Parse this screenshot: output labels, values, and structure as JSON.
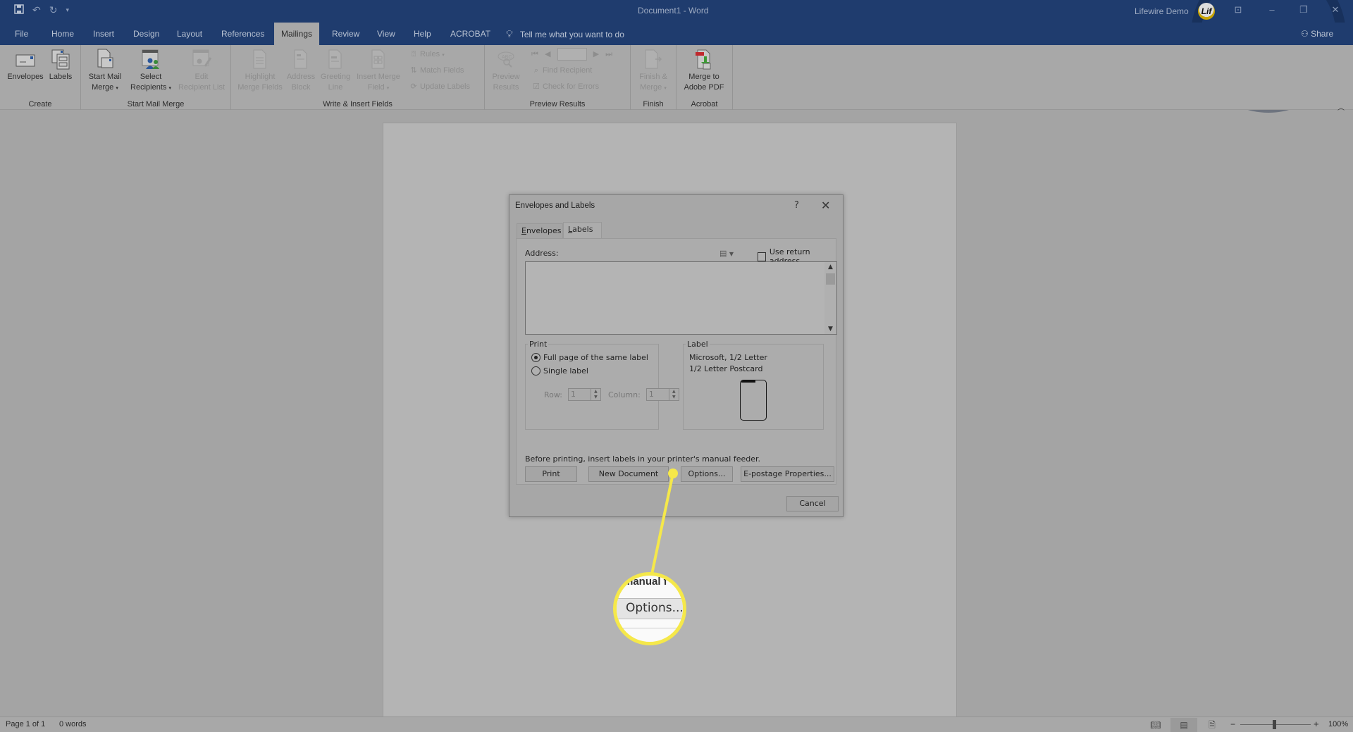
{
  "app": {
    "doc_title": "Document1 - Word",
    "user_name": "Lifewire Demo",
    "avatar_initials": "Lif",
    "share_label": "Share",
    "tell_me": "Tell me what you want to do",
    "colors": {
      "title_bar": "#1f3c6e",
      "callout": "#f5e84a"
    }
  },
  "qat": {
    "save": "save-icon",
    "undo": "undo-icon",
    "redo": "redo-icon",
    "customize": "customize-qat-icon"
  },
  "tabs": [
    {
      "label": "File"
    },
    {
      "label": "Home"
    },
    {
      "label": "Insert"
    },
    {
      "label": "Design"
    },
    {
      "label": "Layout"
    },
    {
      "label": "References"
    },
    {
      "label": "Mailings",
      "active": true
    },
    {
      "label": "Review"
    },
    {
      "label": "View"
    },
    {
      "label": "Help"
    },
    {
      "label": "ACROBAT"
    }
  ],
  "ribbon": {
    "groups": {
      "create": "Create",
      "start_mail_merge": "Start Mail Merge",
      "write_insert": "Write & Insert Fields",
      "preview_results": "Preview Results",
      "finish": "Finish",
      "acrobat": "Acrobat"
    },
    "buttons": {
      "envelopes": "Envelopes",
      "labels": "Labels",
      "start_mail_merge_1": "Start Mail",
      "start_mail_merge_2": "Merge",
      "select_recipients_1": "Select",
      "select_recipients_2": "Recipients",
      "edit_list_1": "Edit",
      "edit_list_2": "Recipient List",
      "highlight_1": "Highlight",
      "highlight_2": "Merge Fields",
      "address_block_1": "Address",
      "address_block_2": "Block",
      "greeting_1": "Greeting",
      "greeting_2": "Line",
      "insert_field_1": "Insert Merge",
      "insert_field_2": "Field",
      "rules": "Rules",
      "match_fields": "Match Fields",
      "update_labels": "Update Labels",
      "preview_1": "Preview",
      "preview_2": "Results",
      "find_recipient": "Find Recipient",
      "check_errors": "Check for Errors",
      "finish_1": "Finish &",
      "finish_2": "Merge",
      "merge_pdf_1": "Merge to",
      "merge_pdf_2": "Adobe PDF"
    },
    "record_value": ""
  },
  "dialog": {
    "title": "Envelopes and Labels",
    "help": "?",
    "close": "✕",
    "tabs": [
      {
        "label": "Envelopes",
        "underline": "E",
        "rest": "nvelopes"
      },
      {
        "label": "Labels",
        "underline": "L",
        "rest": "abels",
        "active": true
      }
    ],
    "address_label": "Address:",
    "address_value": "",
    "use_return_address": "Use return address",
    "use_return_address_checked": false,
    "print_group": {
      "legend": "Print",
      "full_page": "Full page of the same label",
      "single_label": "Single label",
      "selected": "full_page",
      "row_label": "Row:",
      "row_value": "1",
      "column_label": "Column:",
      "column_value": "1"
    },
    "label_group": {
      "legend": "Label",
      "line1": "Microsoft, 1/2 Letter",
      "line2": "1/2 Letter Postcard"
    },
    "note": "Before printing, insert labels in your printer's manual feeder.",
    "buttons": {
      "print": "Print",
      "new_document": "New Document",
      "options": "Options...",
      "epostage": "E-postage Properties...",
      "cancel": "Cancel"
    }
  },
  "callout": {
    "top_text": "manual f",
    "highlight_text": "Options..."
  },
  "status": {
    "page": "Page 1 of 1",
    "words": "0 words",
    "zoom": "100%",
    "zoom_minus": "−",
    "zoom_plus": "+"
  }
}
